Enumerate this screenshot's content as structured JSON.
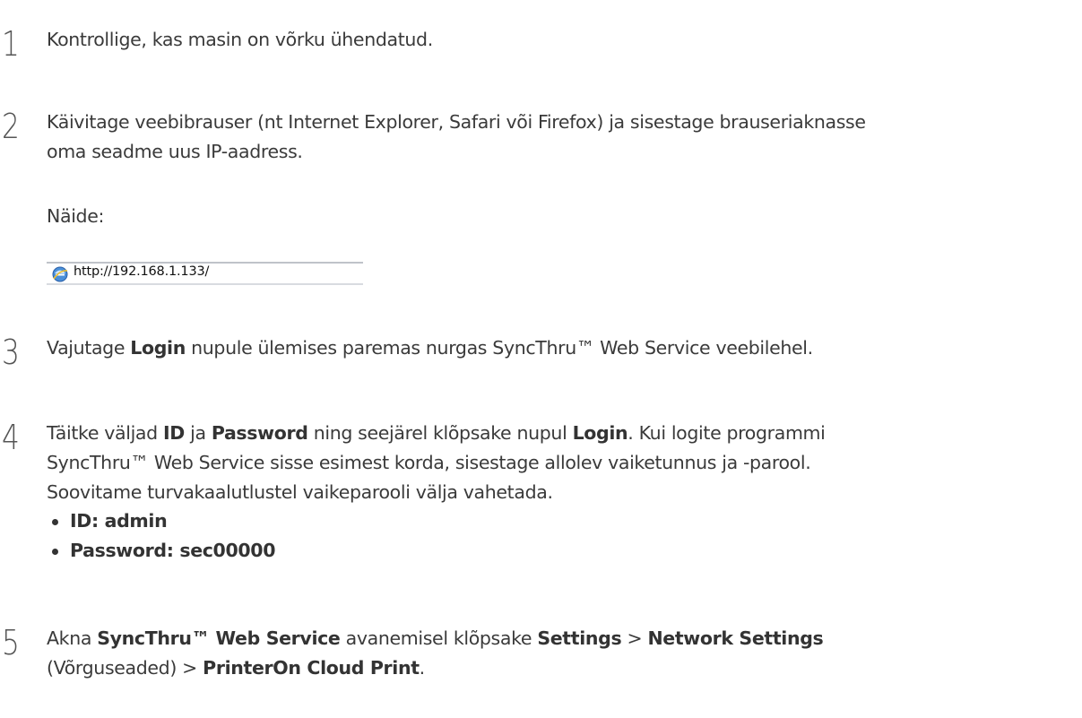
{
  "steps": [
    {
      "number": "1",
      "text": "Kontrollige, kas masin on võrku ühendatud."
    },
    {
      "number": "2",
      "line1": "Käivitage veebibrauser (nt Internet Explorer, Safari või Firefox) ja sisestage brauseriaknasse",
      "line2": "oma seadme uus IP-aadress.",
      "example_label": "Näide:",
      "address_bar": {
        "url": "http://192.168.1.133/",
        "icon": "ie-browser-icon"
      }
    },
    {
      "number": "3",
      "pre": "Vajutage ",
      "bold": "Login",
      "post": " nupule ülemises paremas nurgas SyncThru™ Web Service veebilehel."
    },
    {
      "number": "4",
      "pre": "Täitke väljad ",
      "bold1": "ID",
      "mid1": " ja ",
      "bold2": "Password",
      "mid2": " ning seejärel klõpsake nupul ",
      "bold3": "Login",
      "mid3": ". Kui logite programmi",
      "line2": "SyncThru™ Web Service sisse esimest korda, sisestage allolev vaiketunnus ja -parool.",
      "line3": "Soovitame turvakaalutlustel vaikeparooli välja vahetada.",
      "bullets": [
        "ID: admin",
        "Password: sec00000"
      ]
    },
    {
      "number": "5",
      "pre": "Akna ",
      "bold1": "SyncThru™ Web Service",
      "mid1": " avanemisel klõpsake ",
      "bold2": "Settings",
      "sep1": " > ",
      "bold3": "Network Settings",
      "line2_pre": "(Võrguseaded) > ",
      "bold4": "PrinterOn Cloud Print",
      "line2_post": "."
    }
  ]
}
